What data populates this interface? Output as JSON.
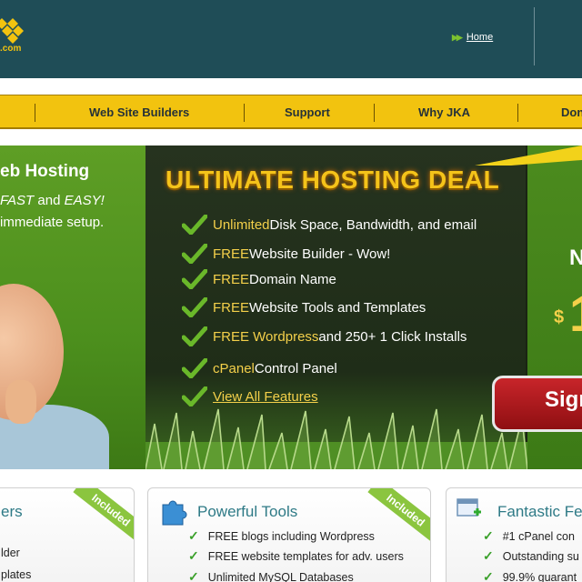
{
  "header": {
    "logo_suffix": ".com",
    "home_link": "Home"
  },
  "nav": {
    "items": [
      "Web Site Builders",
      "Support",
      "Why JKA",
      "Don"
    ]
  },
  "hero": {
    "left": {
      "headline": "eb Hosting",
      "tag_fast": "FAST",
      "tag_and": " and ",
      "tag_easy": "EASY!",
      "tag_line2": "immediate setup."
    },
    "deal": {
      "title": "ULTIMATE HOSTING DEAL",
      "features": [
        {
          "hl": "Unlimited",
          "rest": " Disk Space, Bandwidth, and email"
        },
        {
          "hl": "FREE",
          "rest": " Website Builder - Wow!"
        },
        {
          "hl": "FREE",
          "rest": " Domain Name"
        },
        {
          "hl": "FREE",
          "rest": " Website Tools and Templates"
        },
        {
          "hl": "FREE Wordpress",
          "rest": " and 250+ 1 Click Installs"
        },
        {
          "hl": "cPanel",
          "rest": " Control Panel"
        }
      ],
      "view_all": "View All Features"
    },
    "right": {
      "now": "N",
      "dollar": "$",
      "price_digit": "1",
      "signup": "Sign"
    }
  },
  "panels": [
    {
      "title": "ers",
      "ribbon": "Included",
      "items": [
        "lder",
        "plates"
      ]
    },
    {
      "title": "Powerful Tools",
      "ribbon": "Included",
      "items": [
        "FREE blogs including Wordpress",
        "FREE website templates for adv. users",
        "Unlimited MySQL Databases"
      ]
    },
    {
      "title": "Fantastic Fe",
      "items": [
        "#1 cPanel con",
        "Outstanding su",
        "99.9% guarant"
      ]
    }
  ],
  "colors": {
    "header_bg": "#1f4d57",
    "nav_bg": "#f2c30f",
    "accent_yellow": "#f4c31a",
    "hero_green": "#4c8f1d",
    "panel_title": "#2e7a86",
    "check_green": "#3aa02a",
    "signup_red": "#c8252a"
  }
}
